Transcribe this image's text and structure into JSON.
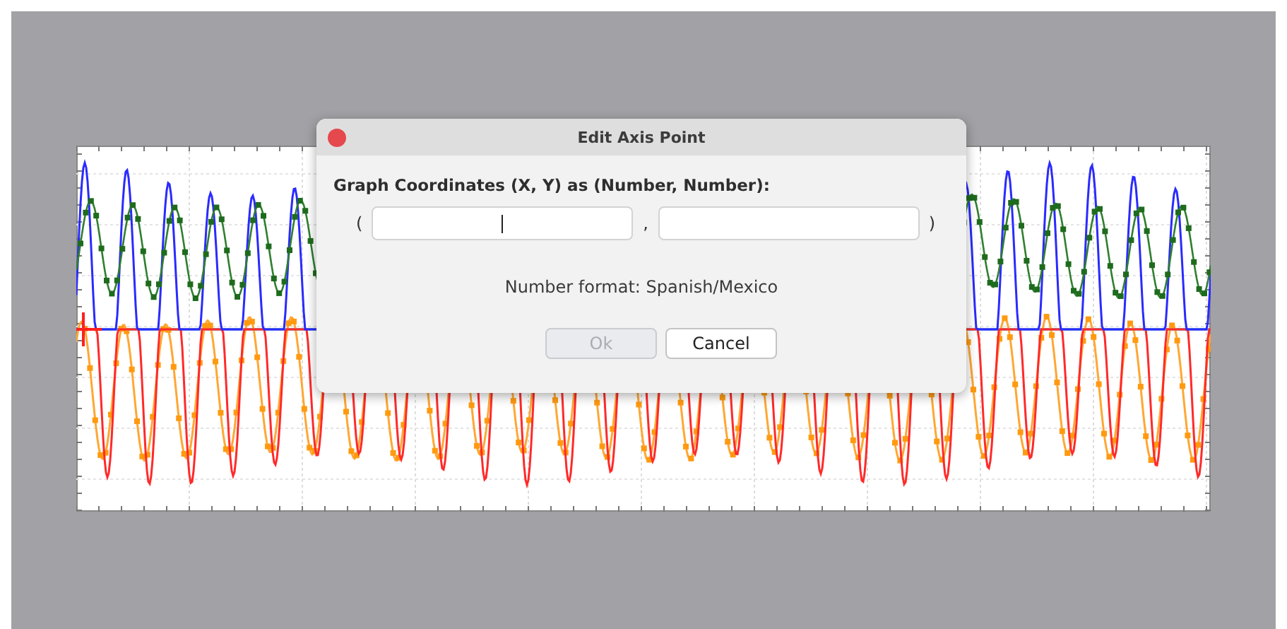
{
  "dialog": {
    "title": "Edit Axis Point",
    "prompt": "Graph Coordinates (X, Y) as (Number, Number):",
    "open_paren": "(",
    "separator": ",",
    "close_paren": ")",
    "fields": [
      {
        "focused": true
      },
      {
        "focused": false
      }
    ],
    "number_format": "Number format: Spanish/Mexico",
    "buttons": [
      {
        "label": "Ok",
        "disabled": true
      },
      {
        "label": "Cancel",
        "disabled": false
      }
    ]
  }
}
